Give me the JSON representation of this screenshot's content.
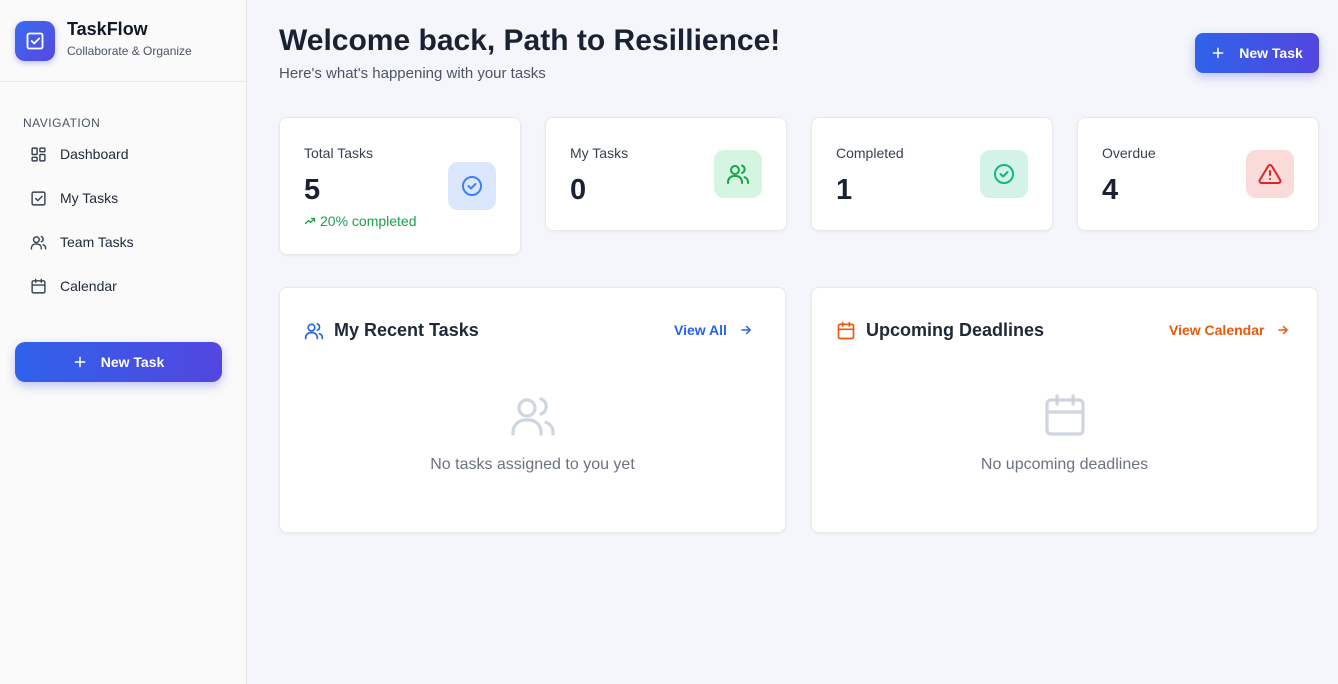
{
  "brand": {
    "title": "TaskFlow",
    "subtitle": "Collaborate & Organize"
  },
  "sidebar": {
    "heading": "NAVIGATION",
    "items": [
      {
        "label": "Dashboard",
        "icon": "dashboard-icon"
      },
      {
        "label": "My Tasks",
        "icon": "checkbox-icon"
      },
      {
        "label": "Team Tasks",
        "icon": "users-icon"
      },
      {
        "label": "Calendar",
        "icon": "calendar-icon"
      }
    ],
    "new_task_label": "New Task"
  },
  "header": {
    "title": "Welcome back, Path to Resillience!",
    "subtitle": "Here's what's happening with your tasks",
    "new_task_label": "New Task"
  },
  "stats": [
    {
      "label": "Total Tasks",
      "value": "5",
      "trend": "20% completed",
      "icon": "check-circle-icon",
      "color": "#3b82f6",
      "bg": "#dbe7fc"
    },
    {
      "label": "My Tasks",
      "value": "0",
      "icon": "users-icon",
      "color": "#16a34a",
      "bg": "#d6f5e1"
    },
    {
      "label": "Completed",
      "value": "1",
      "icon": "check-circle-icon",
      "color": "#10b981",
      "bg": "#d3f3e8"
    },
    {
      "label": "Overdue",
      "value": "4",
      "icon": "alert-triangle-icon",
      "color": "#dc2626",
      "bg": "#fbdada"
    }
  ],
  "panels": {
    "recent": {
      "title": "My Recent Tasks",
      "link": "View All",
      "empty": "No tasks assigned to you yet",
      "accent": "#2563eb"
    },
    "deadlines": {
      "title": "Upcoming Deadlines",
      "link": "View Calendar",
      "empty": "No upcoming deadlines",
      "accent": "#ea580c"
    }
  }
}
